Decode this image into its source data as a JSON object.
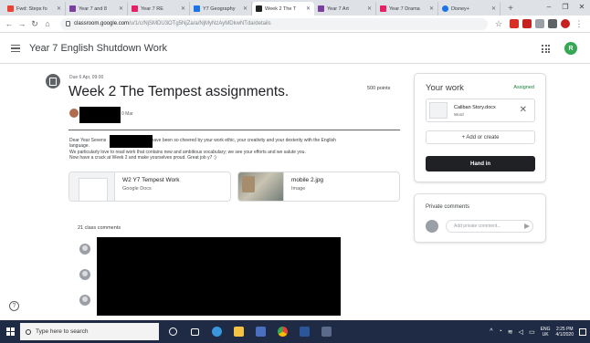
{
  "browser": {
    "tabs": [
      {
        "title": "Fwd: Steps fo",
        "color": "#ea4335",
        "active": false
      },
      {
        "title": "Year 7 and 8",
        "color": "#7b3fa0",
        "active": false
      },
      {
        "title": "Year 7 RE",
        "color": "#e91e63",
        "active": false
      },
      {
        "title": "Y7 Geography",
        "color": "#1a73e8",
        "active": false
      },
      {
        "title": "Week 2 The T",
        "color": "#202124",
        "active": true
      },
      {
        "title": "Year 7 Art",
        "color": "#7b3fa0",
        "active": false
      },
      {
        "title": "Year 7 Drama",
        "color": "#e91e63",
        "active": false
      },
      {
        "title": "Disney+",
        "color": "#1a73e8",
        "active": false
      }
    ],
    "url_host": "classroom.google.com",
    "url_path": "/u/1/c/NjSMDU3OTg5NjZa/a/NjMyNzAyMDkwNTda/details"
  },
  "header": {
    "class_title": "Year 7 English Shutdown Work",
    "avatar_letter": "R",
    "avatar_color": "#34a853"
  },
  "assignment": {
    "due": "Due 6 Apr, 09:00",
    "title": "Week 2 The Tempest assignments.",
    "points": "500 points",
    "author_date": "0 Mar",
    "body_line1_a": "Dear Year Sevens",
    "body_line1_b": "and I have been so cheered by your work ethic, your creativity and your dexterity with the English",
    "body_line2": "language.",
    "body_line3": "We particularly love to read work that contains new and ambitious vocabulary; we see your efforts and we salute you.",
    "body_line4": "Now have a crack at Week 2 and make yourselves proud. Great job y7 :)",
    "attachments": [
      {
        "name": "W2 Y7 Tempest Work",
        "type": "Google Docs"
      },
      {
        "name": "mobile 2.jpg",
        "type": "Image"
      }
    ],
    "comments_label": "21 class comments"
  },
  "your_work": {
    "title": "Your work",
    "status": "Assigned",
    "status_color": "#188038",
    "file_name": "Caliban Story.docx",
    "file_type": "Word",
    "add_label": "+  Add or create",
    "hand_in_label": "Hand in"
  },
  "private_comments": {
    "title": "Private comments",
    "placeholder": "Add private comment..."
  },
  "taskbar": {
    "search_placeholder": "Type here to search",
    "lang_line1": "ENG",
    "lang_line2": "UK",
    "time": "2:25 PM",
    "date": "4/1/2020"
  }
}
